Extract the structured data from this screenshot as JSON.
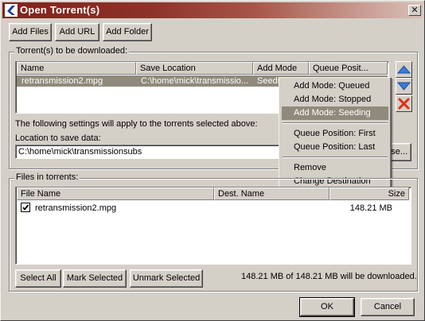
{
  "window": {
    "title": "Open Torrent(s)"
  },
  "toolbar": {
    "add_files": "Add Files",
    "add_url": "Add URL",
    "add_folder": "Add Folder"
  },
  "torrents_group": {
    "label": "Torrent(s) to be downloaded:",
    "columns": [
      "Name",
      "Save Location",
      "Add Mode",
      "Queue Posit..."
    ],
    "rows": [
      {
        "name": "retransmission2.mpg",
        "save_location": "C:\\home\\mick\\transmissio...",
        "add_mode": "Seedi"
      }
    ]
  },
  "settings": {
    "note": "The following settings will apply to the torrents selected above:",
    "location_label": "Location to save data:",
    "location_value": "C:\\home\\mick\\transmissionsubs",
    "browse_label": "rse..."
  },
  "context_menu": {
    "items": [
      "Add Mode: Queued",
      "Add Mode: Stopped",
      "Add Mode: Seeding",
      "Queue Position: First",
      "Queue Position: Last",
      "Remove",
      "Change Destination"
    ],
    "selected": "Add Mode: Seeding"
  },
  "files_group": {
    "label": "Files in torrents:",
    "columns": [
      "File Name",
      "Dest. Name",
      "Size"
    ],
    "rows": [
      {
        "checked": true,
        "file_name": "retransmission2.mpg",
        "size": "148.21 MB"
      }
    ]
  },
  "footer": {
    "select_all": "Select All",
    "mark_selected": "Mark Selected",
    "unmark_selected": "Unmark Selected",
    "summary": "148.21 MB of 148.21 MB will be downloaded.",
    "ok": "OK",
    "cancel": "Cancel"
  },
  "colors": {
    "title_bar": "#80221b",
    "selection": "#908a7c",
    "up_arrow": "#3a7bd5",
    "remove_x": "#e03010"
  }
}
